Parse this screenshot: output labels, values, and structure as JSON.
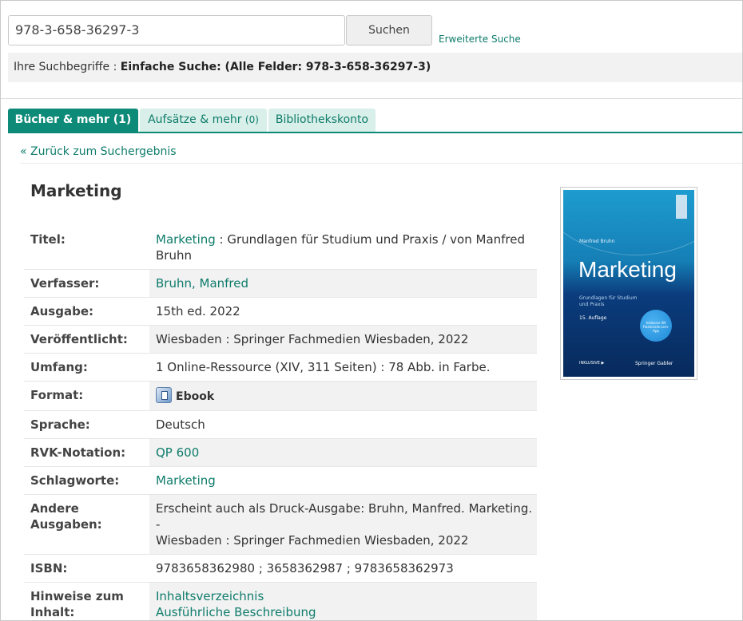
{
  "search": {
    "value": "978-3-658-36297-3",
    "button_label": "Suchen",
    "advanced_link": "Erweiterte Suche"
  },
  "search_terms": {
    "prefix": "Ihre Suchbegriffe : ",
    "value": "Einfache Suche: (Alle Felder: 978-3-658-36297-3)"
  },
  "tabs": [
    {
      "label": "Bücher & mehr",
      "count": "(1)",
      "active": true
    },
    {
      "label": "Aufsätze & mehr",
      "count": "(0)",
      "active": false
    },
    {
      "label": "Bibliothekskonto",
      "count": "",
      "active": false
    }
  ],
  "back_link": "« Zurück zum Suchergebnis",
  "record": {
    "title": "Marketing",
    "titel_label": "Titel:",
    "titel_link": "Marketing",
    "titel_rest": " : Grundlagen für Studium und Praxis / von Manfred Bruhn",
    "verfasser_label": "Verfasser:",
    "verfasser": "Bruhn, Manfred",
    "ausgabe_label": "Ausgabe:",
    "ausgabe": "15th ed. 2022",
    "veroeffentlicht_label": "Veröffentlicht:",
    "veroeffentlicht": "Wiesbaden : Springer Fachmedien Wiesbaden, 2022",
    "umfang_label": "Umfang:",
    "umfang": "1 Online-Ressource (XIV, 311 Seiten) : 78 Abb. in Farbe.",
    "format_label": "Format:",
    "format": "Ebook",
    "format_icon": "ebook-icon",
    "sprache_label": "Sprache:",
    "sprache": "Deutsch",
    "rvk_label": "RVK-Notation:",
    "rvk": "QP 600",
    "schlagworte_label": "Schlagworte:",
    "schlagworte": "Marketing",
    "andere_label_1": "Andere",
    "andere_label_2": "Ausgaben:",
    "andere_1": "Erscheint auch als Druck-Ausgabe: Bruhn, Manfred. Marketing. -",
    "andere_2": "Wiesbaden : Springer Fachmedien Wiesbaden, 2022",
    "isbn_label": "ISBN:",
    "isbn": "9783658362980 ; 3658362987 ; 9783658362973",
    "hinweise_label_1": "Hinweise zum",
    "hinweise_label_2": "Inhalt:",
    "hinweise_link_1": "Inhaltsverzeichnis",
    "hinweise_link_2": "Ausführliche Beschreibung"
  },
  "cover": {
    "author": "Manfred Bruhn",
    "title": "Marketing",
    "subtitle_1": "Grundlagen für Studium",
    "subtitle_2": "und Praxis",
    "edition": "15. Auflage",
    "badge": "Inklusive SN Flashcards Lern-App",
    "logo_left": "INKLUSIVE ▶",
    "logo_right": "Springer Gabler"
  },
  "colors": {
    "accent": "#0e8a78",
    "link": "#0e7c6b",
    "tab_inactive_bg": "#d9efe9",
    "row_shade": "#f2f2f2"
  }
}
